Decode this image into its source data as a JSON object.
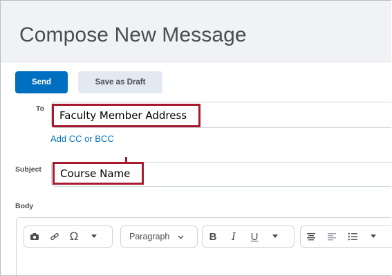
{
  "header": {
    "title": "Compose New Message"
  },
  "actions": {
    "send_label": "Send",
    "draft_label": "Save as Draft"
  },
  "to": {
    "label": "To",
    "value": "Faculty Member Address",
    "add_cc_bcc": "Add CC or BCC"
  },
  "subject": {
    "label": "Subject",
    "value": "Course Name"
  },
  "body": {
    "label": "Body"
  },
  "toolbar": {
    "format_select": "Paragraph",
    "bold": "B",
    "italic": "I",
    "underline": "U",
    "icons": [
      "camera-icon",
      "link-icon",
      "omega-icon",
      "chevron-down-icon",
      "bold-icon",
      "italic-icon",
      "underline-icon",
      "align-center-icon",
      "align-left-icon",
      "list-icon"
    ]
  },
  "colors": {
    "primary": "#006fbf",
    "highlight": "#a6192e",
    "header_bg": "#f1f2f4"
  }
}
